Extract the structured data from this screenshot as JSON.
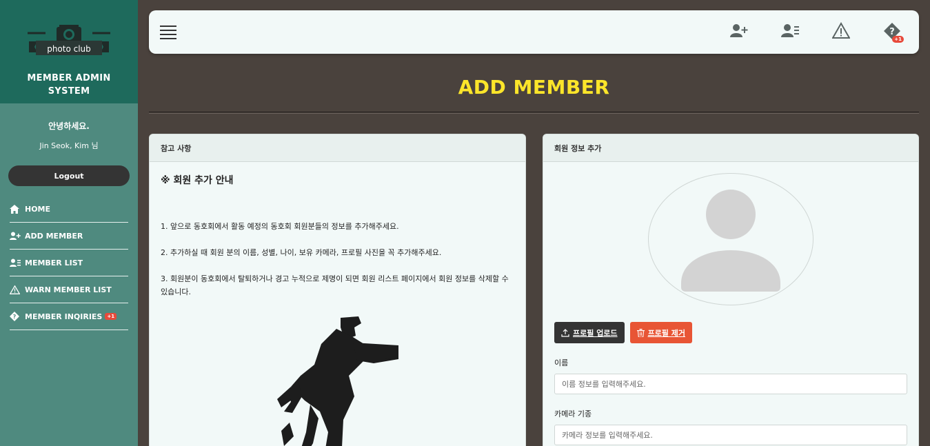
{
  "sidebar": {
    "logo_text": "photo club",
    "brand_title_line1": "MEMBER ADMIN",
    "brand_title_line2": "SYSTEM",
    "greeting": "안녕하세요.",
    "user_name": "Jin Seok, Kim 님",
    "logout_label": "Logout",
    "nav": [
      {
        "label": "HOME",
        "icon": "home-icon"
      },
      {
        "label": "ADD MEMBER",
        "icon": "user-plus-icon"
      },
      {
        "label": "MEMBER LIST",
        "icon": "user-list-icon"
      },
      {
        "label": "WARN MEMBER LIST",
        "icon": "warning-icon"
      },
      {
        "label": "MEMBER INQIRIES",
        "icon": "question-icon",
        "badge": "+1"
      }
    ]
  },
  "topbar": {
    "icons": [
      "user-plus-icon",
      "user-list-icon",
      "warning-icon",
      "question-icon"
    ],
    "inquiry_badge": "+1"
  },
  "page": {
    "title": "ADD MEMBER"
  },
  "notice_card": {
    "header": "참고 사항",
    "title": "※ 회원 추가 안내",
    "items": [
      "1. 앞으로 동호회에서 활동 예정의 동호회 회원분들의 정보를 추가해주세요.",
      "2. 추가하실 때 회원 분의 이름, 성별, 나이, 보유 카메라, 프로필 사진을 꼭 추가해주세요.",
      "3. 회원분이 동호회에서 탈퇴하거나 경고 누적으로 제명이 되면 회원 리스트 페이지에서 회원 정보를 삭제할 수 있습니다."
    ]
  },
  "form_card": {
    "header": "회원 정보 추가",
    "upload_label": "프로필 업로드",
    "remove_label": "프로필 제거",
    "name_label": "이름",
    "name_placeholder": "이름 정보를 입력해주세요.",
    "camera_label": "카메라 기종",
    "camera_placeholder": "카메라 정보를 입력해주세요."
  },
  "colors": {
    "sidebar_bg": "#4f8a7f",
    "brand_bg": "#1e6a5c",
    "page_bg": "#4a423d",
    "title_yellow": "#fce52a",
    "danger": "#e85535"
  }
}
